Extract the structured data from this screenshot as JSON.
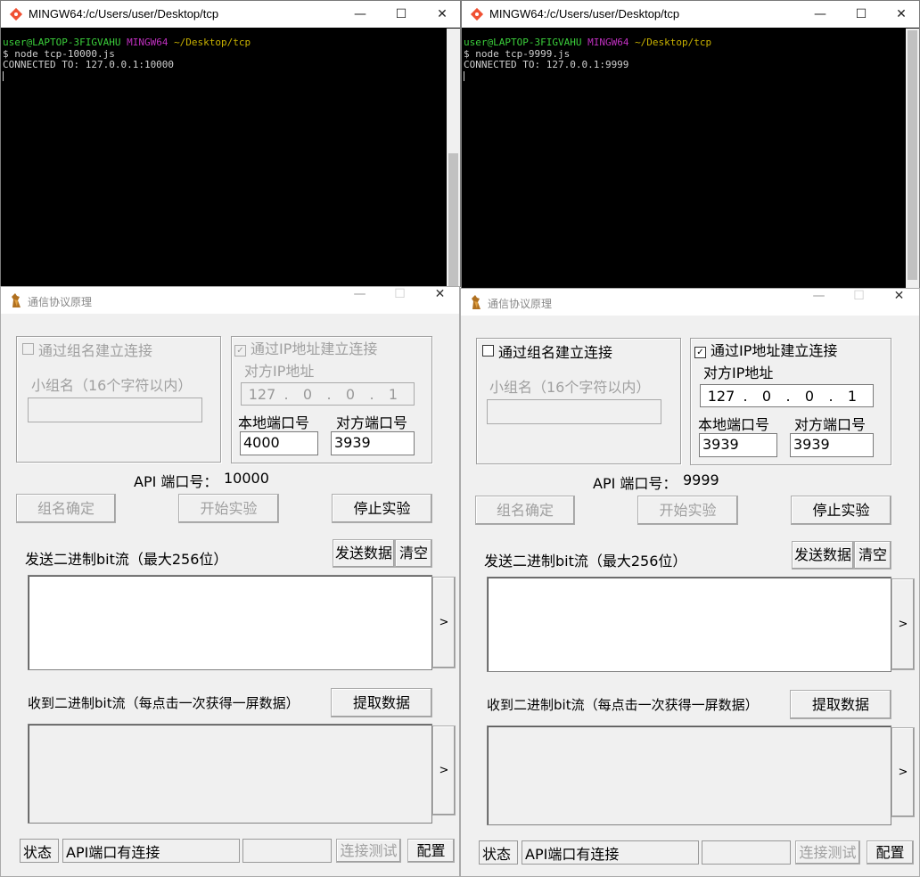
{
  "terminals": [
    {
      "title": "MINGW64:/c/Users/user/Desktop/tcp",
      "prompt_user": "user@LAPTOP-3FIGVAHU",
      "prompt_shell": "MINGW64",
      "prompt_path": "~/Desktop/tcp",
      "command": "$ node tcp-10000.js",
      "output": "CONNECTED TO: 127.0.0.1:10000"
    },
    {
      "title": "MINGW64:/c/Users/user/Desktop/tcp",
      "prompt_user": "user@LAPTOP-3FIGVAHU",
      "prompt_shell": "MINGW64",
      "prompt_path": "~/Desktop/tcp",
      "command": "$ node tcp-9999.js",
      "output": "CONNECTED TO: 127.0.0.1:9999"
    }
  ],
  "window_controls": {
    "minimize": "—",
    "maximize": "☐",
    "close": "✕"
  },
  "dialogs": [
    {
      "title": "通信协议原理",
      "group_connect_label": "通过组名建立连接",
      "group_connect_checked": false,
      "group_name_label": "小组名（16个字符以内）",
      "group_name_value": "",
      "ip_connect_label": "通过IP地址建立连接",
      "ip_connect_checked": true,
      "peer_ip_label": "对方IP地址",
      "ip": [
        "127",
        "0",
        "0",
        "1"
      ],
      "ip_dot": ".",
      "local_port_label": "本地端口号",
      "local_port": "4000",
      "peer_port_label": "对方端口号",
      "peer_port": "3939",
      "api_port_label": "API 端口号：",
      "api_port": "10000",
      "btn_group_confirm": "组名确定",
      "btn_start": "开始实验",
      "btn_stop": "停止实验",
      "send_label": "发送二进制bit流（最大256位）",
      "btn_send": "发送数据",
      "btn_clear": "清空",
      "arrow": ">",
      "recv_label": "收到二进制bit流（每点击一次获得一屏数据）",
      "btn_fetch": "提取数据",
      "status_label": "状态",
      "status_text": "API端口有连接",
      "status_extra": "",
      "btn_conn_test": "连接测试",
      "btn_config": "配置"
    },
    {
      "title": "通信协议原理",
      "group_connect_label": "通过组名建立连接",
      "group_connect_checked": false,
      "group_name_label": "小组名（16个字符以内）",
      "group_name_value": "",
      "ip_connect_label": "通过IP地址建立连接",
      "ip_connect_checked": true,
      "peer_ip_label": "对方IP地址",
      "ip": [
        "127",
        "0",
        "0",
        "1"
      ],
      "ip_dot": ".",
      "local_port_label": "本地端口号",
      "local_port": "3939",
      "peer_port_label": "对方端口号",
      "peer_port": "3939",
      "api_port_label": "API 端口号：",
      "api_port": "9999",
      "btn_group_confirm": "组名确定",
      "btn_start": "开始实验",
      "btn_stop": "停止实验",
      "send_label": "发送二进制bit流（最大256位）",
      "btn_send": "发送数据",
      "btn_clear": "清空",
      "arrow": ">",
      "recv_label": "收到二进制bit流（每点击一次获得一屏数据）",
      "btn_fetch": "提取数据",
      "status_label": "状态",
      "status_text": "API端口有连接",
      "status_extra": "",
      "btn_conn_test": "连接测试",
      "btn_config": "配置"
    }
  ]
}
